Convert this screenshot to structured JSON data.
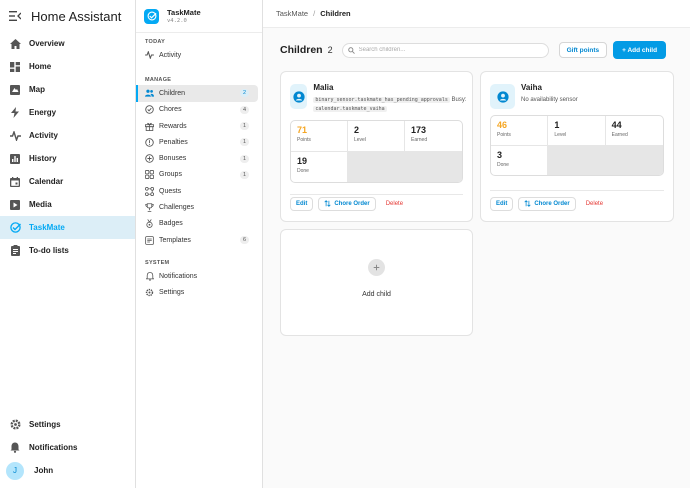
{
  "app": {
    "title": "Home Assistant"
  },
  "nav": [
    {
      "label": "Overview",
      "icon": "overview-icon"
    },
    {
      "label": "Home",
      "icon": "home-dashboard-icon"
    },
    {
      "label": "Map",
      "icon": "map-icon"
    },
    {
      "label": "Energy",
      "icon": "energy-icon"
    },
    {
      "label": "Activity",
      "icon": "activity-icon"
    },
    {
      "label": "History",
      "icon": "history-icon"
    },
    {
      "label": "Calendar",
      "icon": "calendar-icon"
    },
    {
      "label": "Media",
      "icon": "media-icon"
    },
    {
      "label": "TaskMate",
      "icon": "taskmate-icon",
      "active": true
    },
    {
      "label": "To-do lists",
      "icon": "todo-icon"
    }
  ],
  "nav_bottom": {
    "settings": "Settings",
    "notifications": "Notifications",
    "user": {
      "initial": "J",
      "name": "John"
    }
  },
  "taskmate": {
    "name": "TaskMate",
    "version": "v4.2.0",
    "sections": {
      "today": "TODAY",
      "manage": "MANAGE",
      "system": "SYSTEM"
    },
    "today_items": [
      {
        "label": "Activity"
      }
    ],
    "manage_items": [
      {
        "label": "Children",
        "count": "2"
      },
      {
        "label": "Chores",
        "count": "4"
      },
      {
        "label": "Rewards",
        "count": "1"
      },
      {
        "label": "Penalties",
        "count": "1"
      },
      {
        "label": "Bonuses",
        "count": "1"
      },
      {
        "label": "Groups",
        "count": "1"
      },
      {
        "label": "Quests"
      },
      {
        "label": "Challenges"
      },
      {
        "label": "Badges"
      },
      {
        "label": "Templates",
        "count": "6"
      }
    ],
    "system_items": [
      {
        "label": "Notifications"
      },
      {
        "label": "Settings"
      }
    ]
  },
  "breadcrumb": {
    "root": "TaskMate",
    "current": "Children"
  },
  "toolbar": {
    "title": "Children",
    "count": "2",
    "search_placeholder": "Search children...",
    "gift_points": "Gift points",
    "add_child": "+ Add child"
  },
  "children": [
    {
      "name": "Malia",
      "availability_sensor": "binary_sensor.taskmate_has_pending_approvals",
      "busy_label": "Busy:",
      "busy_calendar": "calendar.taskmate_vaiha",
      "stats": {
        "points": "71",
        "level": "2",
        "earned": "173",
        "done": "19"
      }
    },
    {
      "name": "Vaiha",
      "subtitle": "No availability sensor",
      "stats": {
        "points": "46",
        "level": "1",
        "earned": "44",
        "done": "3"
      }
    }
  ],
  "stat_labels": {
    "points": "Points",
    "level": "Level",
    "earned": "Earned",
    "done": "Done"
  },
  "card_actions": {
    "edit": "Edit",
    "chore_order": "Chore Order",
    "delete": "Delete"
  },
  "add_child_card": {
    "label": "Add child"
  },
  "colors": {
    "accent": "#03a9f4",
    "points": "#f5a623",
    "delete": "#e53935"
  }
}
